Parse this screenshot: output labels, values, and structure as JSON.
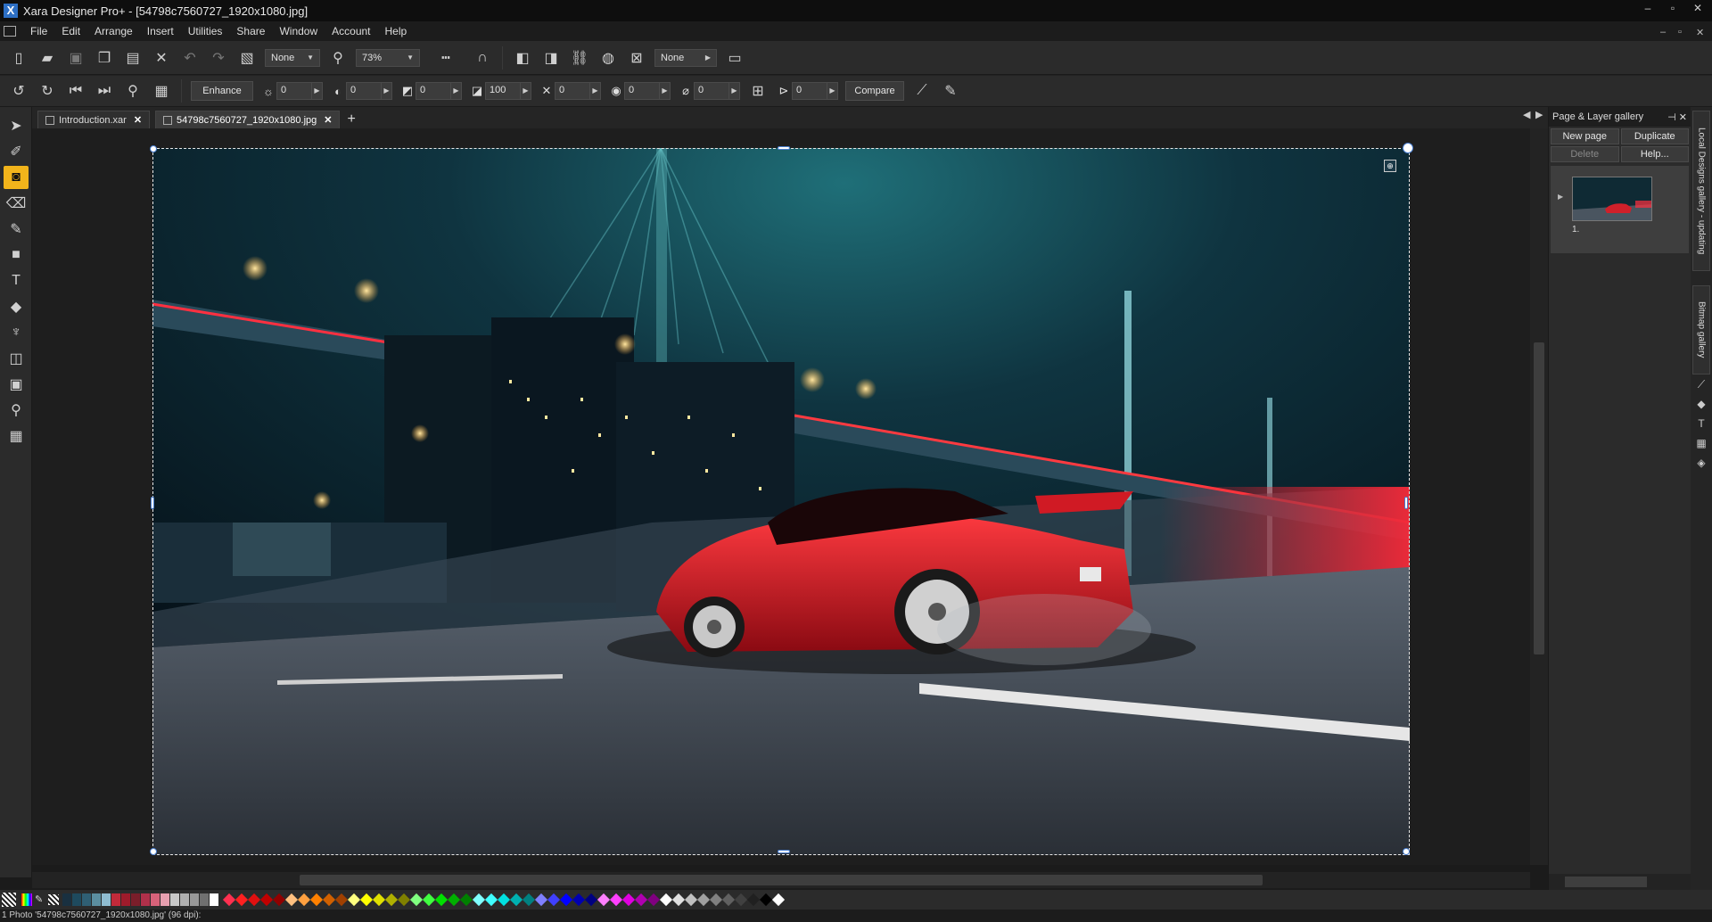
{
  "window": {
    "title": "Xara Designer Pro+ - [54798c7560727_1920x1080.jpg]",
    "controls": [
      "–",
      "▫",
      "✕"
    ],
    "mdi_controls": [
      "–",
      "▫",
      "✕"
    ]
  },
  "menu": [
    "File",
    "Edit",
    "Arrange",
    "Insert",
    "Utilities",
    "Share",
    "Window",
    "Account",
    "Help"
  ],
  "toolbar1": {
    "quality_dropdown": "None",
    "zoom_dropdown": "73%",
    "feather_dropdown": "None"
  },
  "toolbar2": {
    "enhance_label": "Enhance",
    "brightness": "0",
    "contrast": "0",
    "saturation": "0",
    "temperature": "100",
    "sharpness": "0",
    "blur": "0",
    "transparency": "0",
    "rotation": "0",
    "compare_label": "Compare"
  },
  "tabs": [
    {
      "label": "Introduction.xar"
    },
    {
      "label": "54798c7560727_1920x1080.jpg"
    }
  ],
  "right_panel": {
    "title": "Page & Layer gallery",
    "buttons": [
      "New page",
      "Duplicate",
      "Delete",
      "Help..."
    ],
    "page_number": "1."
  },
  "side_tabs": {
    "local_designs": "Local Designs gallery - updating",
    "bitmap": "Bitmap gallery"
  },
  "palette": {
    "squares": [
      "#193040",
      "#1e4a5e",
      "#2f5f74",
      "#5b8ea0",
      "#8fbcd0",
      "#c22a3a",
      "#9e1b2b",
      "#7a1e2a",
      "#b0304a",
      "#d8627a",
      "#e8a0b0",
      "#c8c8c8",
      "#b0b0b0",
      "#989898",
      "#707070",
      "#ffffff"
    ],
    "diamonds": [
      "#ff3050",
      "#ff2020",
      "#e01010",
      "#c00000",
      "#900000",
      "#ffc080",
      "#ffa040",
      "#ff8000",
      "#d06000",
      "#a04000",
      "#ffff80",
      "#ffff00",
      "#e0e000",
      "#b0b000",
      "#808000",
      "#80ff80",
      "#40ff40",
      "#00e000",
      "#00b000",
      "#008000",
      "#80ffff",
      "#40ffff",
      "#00e0e0",
      "#00b0b0",
      "#008080",
      "#8080ff",
      "#4040ff",
      "#0000ff",
      "#0000b0",
      "#000080",
      "#ff80ff",
      "#ff40ff",
      "#e000e0",
      "#b000b0",
      "#800080",
      "#ffffff",
      "#e0e0e0",
      "#c0c0c0",
      "#a0a0a0",
      "#808080",
      "#606060",
      "#404040",
      "#202020",
      "#000000",
      "#ffffff"
    ]
  },
  "status": "1 Photo '54798c7560727_1920x1080.jpg' (96 dpi):"
}
